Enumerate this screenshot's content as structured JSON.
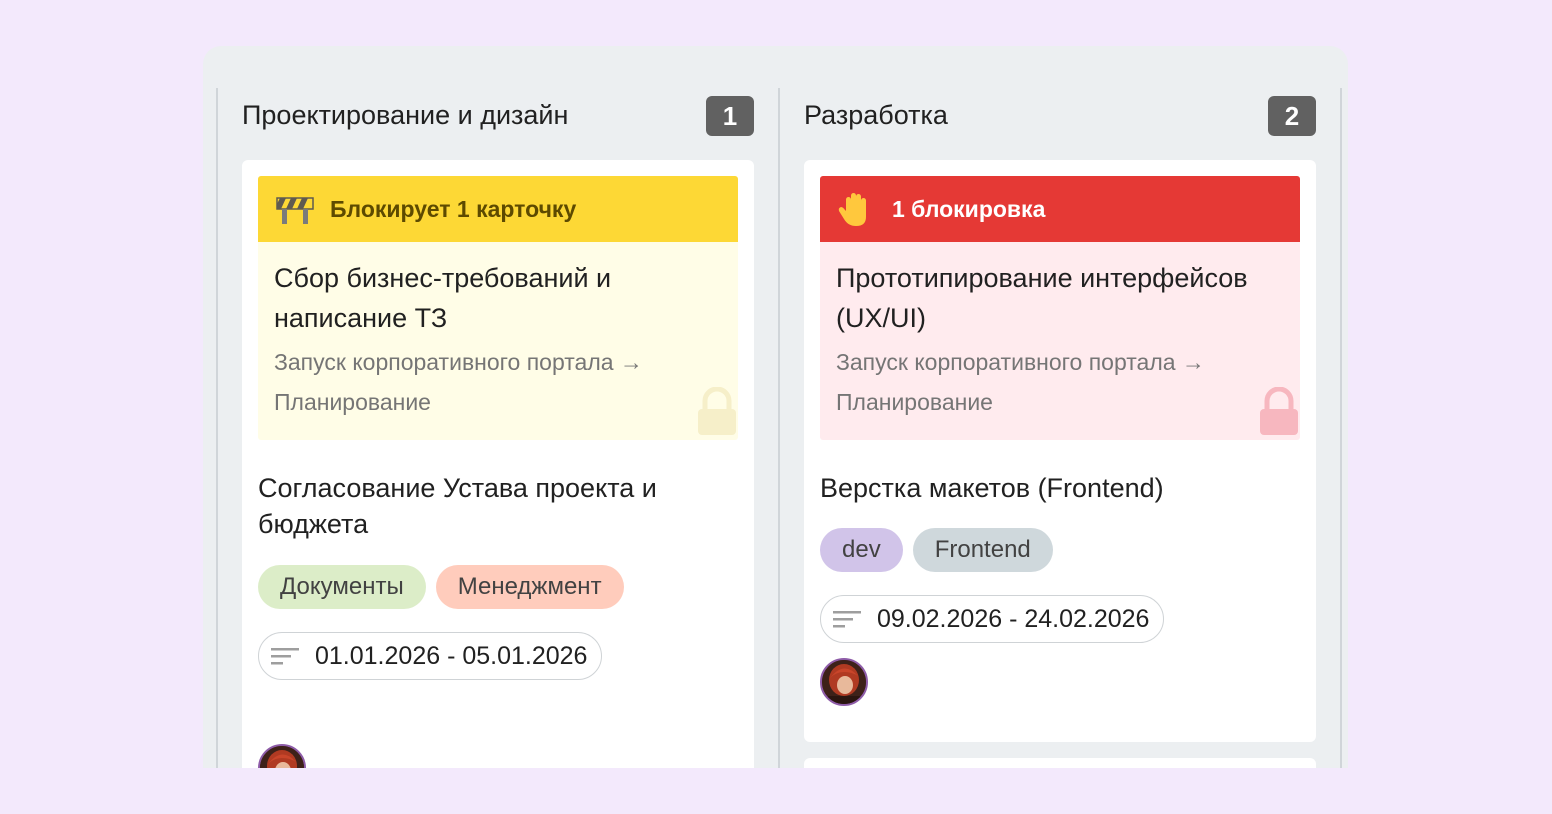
{
  "columns": [
    {
      "title": "Проектирование и дизайн",
      "count": "1",
      "blocker": {
        "label": "Блокирует 1 карточку",
        "linked_title": "Сбор бизнес-требований и написание ТЗ",
        "linked_path": "Запуск корпоративного портала → Планирование",
        "bar_color": "#fdd835",
        "body_color": "#fffde7",
        "text_color": "#5d4a00",
        "icon": "barrier-icon"
      },
      "task": {
        "title": "Согласование Устава проекта и бюджета",
        "tags": [
          {
            "label": "Документы",
            "color": "#dcedc8"
          },
          {
            "label": "Менеджмент",
            "color": "#ffccbc"
          }
        ],
        "dates": "01.01.2026 - 05.01.2026"
      }
    },
    {
      "title": "Разработка",
      "count": "2",
      "blocker": {
        "label": "1 блокировка",
        "linked_title": "Прототипирование интерфейсов (UX/UI)",
        "linked_path": "Запуск корпоративного портала → Планирование",
        "bar_color": "#e53935",
        "body_color": "#ffebee",
        "text_color": "#ffffff",
        "icon": "hand-stop-icon"
      },
      "task": {
        "title": "Верстка макетов (Frontend)",
        "tags": [
          {
            "label": "dev",
            "color": "#d1c4e9"
          },
          {
            "label": "Frontend",
            "color": "#cfd8dc"
          }
        ],
        "dates": "09.02.2026 - 24.02.2026"
      }
    }
  ]
}
